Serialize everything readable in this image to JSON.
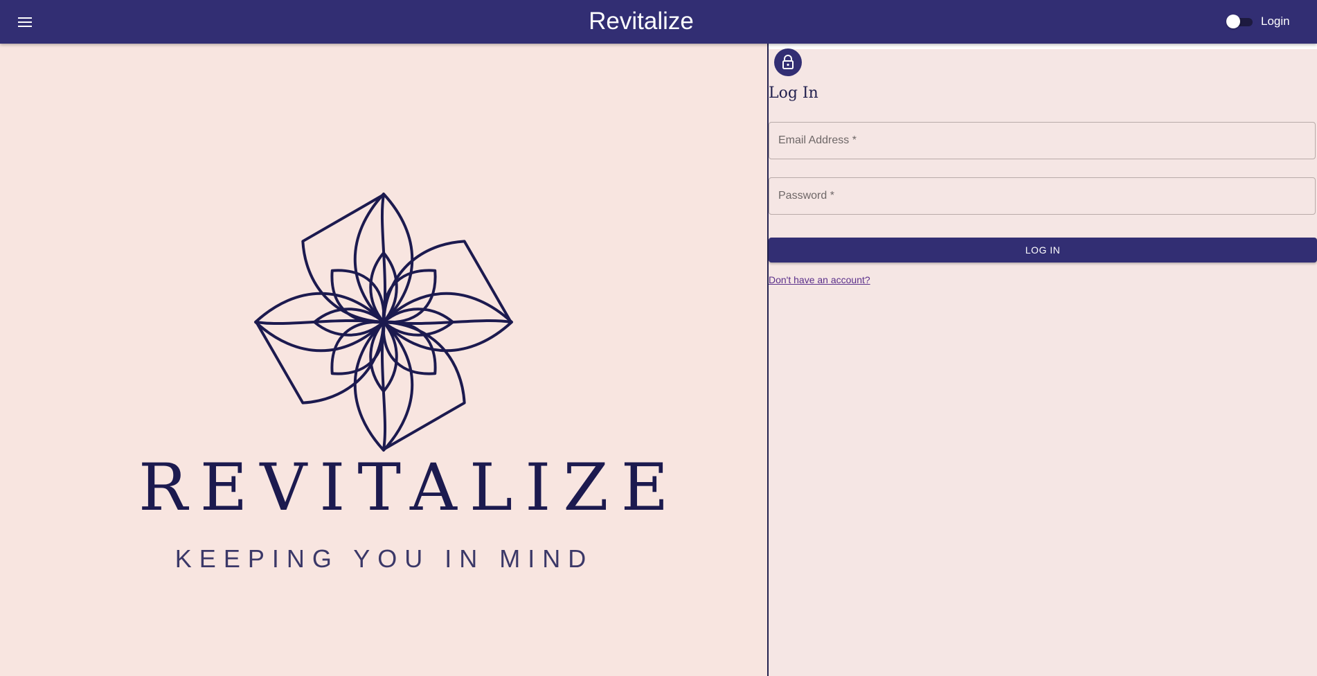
{
  "appbar": {
    "title": "Revitalize",
    "menu_icon": "menu-icon",
    "toggle_label": "Login",
    "toggle_on": false,
    "background": "#322e73"
  },
  "hero": {
    "logo_icon": "lotus-flower-logo",
    "brand_word": "REVITALIZE",
    "tagline": "KEEPING YOU IN MIND",
    "logo_color": "#1c1a4f"
  },
  "login_form": {
    "avatar_icon": "lock-icon",
    "title": "Log In",
    "email_placeholder": "Email Address *",
    "email_value": "",
    "password_placeholder": "Password *",
    "password_value": "",
    "submit_label": "LOG IN",
    "signup_link": "Don't have an account?"
  }
}
